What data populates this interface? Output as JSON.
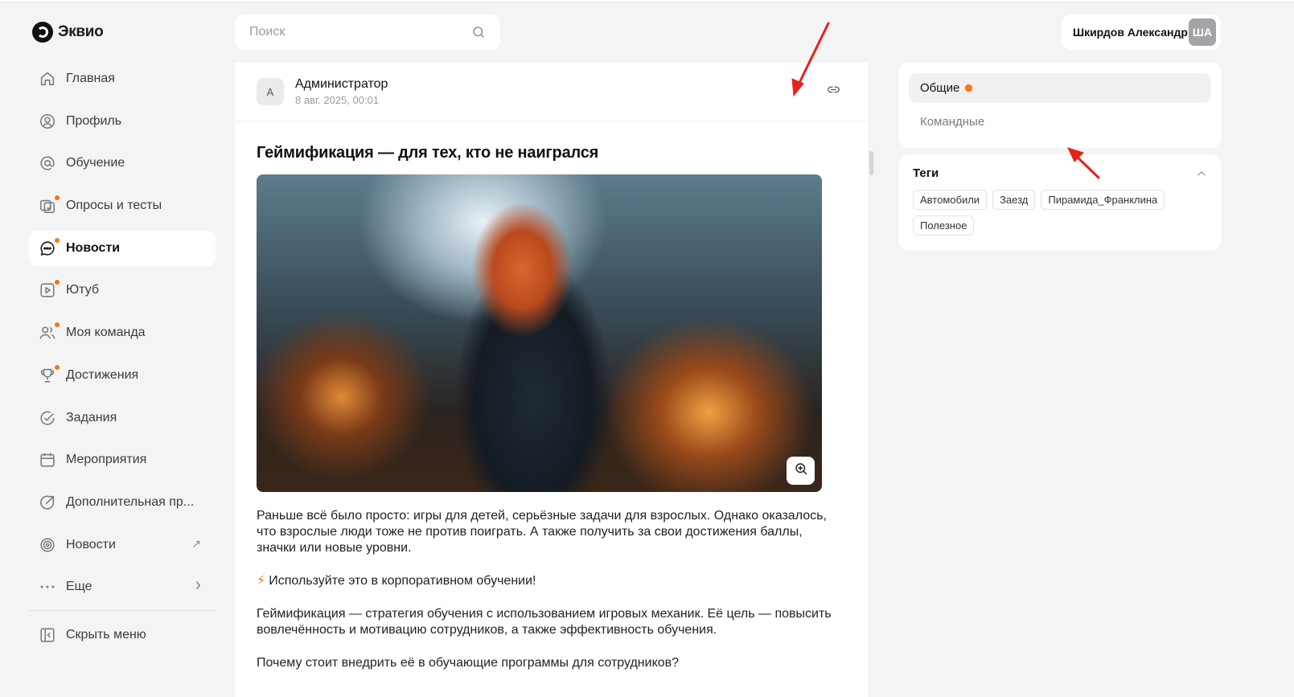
{
  "brand": {
    "name": "Эквио"
  },
  "sidebar": {
    "items": [
      {
        "label": "Главная",
        "icon": "home-icon",
        "dot": false,
        "active": false
      },
      {
        "label": "Профиль",
        "icon": "user-circle-icon",
        "dot": false,
        "active": false
      },
      {
        "label": "Обучение",
        "icon": "at-sign-icon",
        "dot": false,
        "active": false
      },
      {
        "label": "Опросы и тесты",
        "icon": "checklist-icon",
        "dot": true,
        "active": false
      },
      {
        "label": "Новости",
        "icon": "chat-bubble-icon",
        "dot": true,
        "active": true
      },
      {
        "label": "Ютуб",
        "icon": "video-play-icon",
        "dot": true,
        "active": false
      },
      {
        "label": "Моя команда",
        "icon": "team-icon",
        "dot": true,
        "active": false
      },
      {
        "label": "Достижения",
        "icon": "trophy-icon",
        "dot": true,
        "active": false
      },
      {
        "label": "Задания",
        "icon": "check-circle-icon",
        "dot": false,
        "active": false
      },
      {
        "label": "Мероприятия",
        "icon": "calendar-icon",
        "dot": false,
        "active": false
      },
      {
        "label": "Дополнительная пр...",
        "icon": "arrow-circle-icon",
        "dot": false,
        "active": false
      },
      {
        "label": "Новости",
        "icon": "target-icon",
        "dot": false,
        "active": false,
        "extra": "↗"
      },
      {
        "label": "Еще",
        "icon": "more-dots-icon",
        "dot": false,
        "active": false,
        "extra": "›"
      }
    ],
    "collapse_label": "Скрыть меню"
  },
  "search": {
    "placeholder": "Поиск"
  },
  "post": {
    "author_initial": "А",
    "author": "Администратор",
    "date": "8 авг. 2025, 00:01",
    "title": "Геймификация — для тех, кто не наигрался",
    "paragraphs": [
      "Раньше всё было просто: игры для детей, серьёзные задачи для взрослых. Однако оказалось, что взрослые люди тоже не против поиграть. А также получить за свои достижения баллы, значки или новые уровни.",
      "Используйте это в корпоративном обучении!",
      "Геймификация — стратегия обучения с использованием игровых механик.  Её цель — повысить вовлечённость и мотивацию сотрудников, а также эффективность обучения.",
      "Почему стоит внедрить её в обучающие программы для сотрудников?"
    ],
    "bolt_icon": "⚡"
  },
  "user": {
    "name": "Шкирдов Александр",
    "initials": "ША"
  },
  "feeds": {
    "items": [
      {
        "label": "Общие",
        "active": true,
        "dot": true
      },
      {
        "label": "Командные",
        "active": false,
        "dot": false
      }
    ]
  },
  "tags": {
    "title": "Теги",
    "items": [
      "Автомобили",
      "Заезд",
      "Пирамида_Франклина",
      "Полезное"
    ]
  },
  "colors": {
    "accent": "#f97316",
    "annotation": "#e8201a"
  }
}
